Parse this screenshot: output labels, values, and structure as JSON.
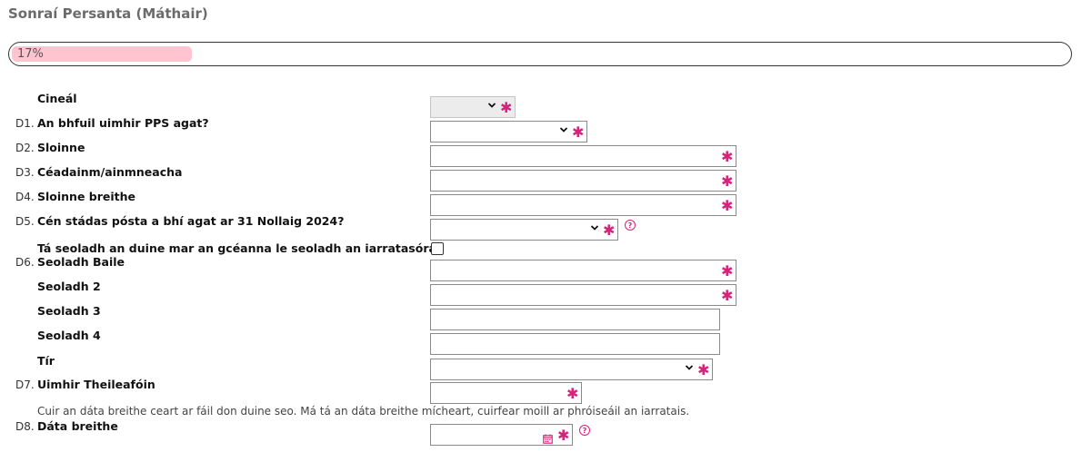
{
  "page": {
    "title": "Sonraí Persanta (Máthair)"
  },
  "progress": {
    "percent": 17,
    "label": "17%"
  },
  "colors": {
    "required": "#d4237a",
    "progress_fill": "#ffc4cf",
    "title": "#6b6b6b"
  },
  "icons": {
    "required": "asterisk-icon",
    "help": "question-circle-icon",
    "calendar": "calendar-icon",
    "dropdown": "chevron-down-icon"
  },
  "form": {
    "cineal": {
      "number": "",
      "label": "Cineál",
      "required_mark": "✱"
    },
    "d1": {
      "number": "D1.",
      "label": "An bhfuil uimhir PPS agat?",
      "required_mark": "✱"
    },
    "d2": {
      "number": "D2.",
      "label": "Sloinne",
      "value": "",
      "required_mark": "✱"
    },
    "d3": {
      "number": "D3.",
      "label": "Céadainm/ainmneacha",
      "value": "",
      "required_mark": "✱"
    },
    "d4": {
      "number": "D4.",
      "label": "Sloinne breithe",
      "value": "",
      "required_mark": "✱"
    },
    "d5": {
      "number": "D5.",
      "label": "Cén stádas pósta a bhí agat ar 31 Nollaig 2024?",
      "required_mark": "✱",
      "help": "?"
    },
    "same_address": {
      "label": "Tá seoladh an duine mar an gcéanna le seoladh an iarratasóra."
    },
    "d6": {
      "number": "D6.",
      "label": "Seoladh Baile",
      "value": "",
      "required_mark": "✱"
    },
    "addr2": {
      "label": "Seoladh 2",
      "value": "",
      "required_mark": "✱"
    },
    "addr3": {
      "label": "Seoladh 3",
      "value": ""
    },
    "addr4": {
      "label": "Seoladh 4",
      "value": ""
    },
    "country": {
      "label": "Tír",
      "required_mark": "✱"
    },
    "d7": {
      "number": "D7.",
      "label": "Uimhir Theileafóin",
      "value": "",
      "required_mark": "✱"
    },
    "dob_note": "Cuir an dáta breithe ceart ar fáil don duine seo. Má tá an dáta breithe mícheart, cuirfear moill ar phróiseáil an iarratais.",
    "d8": {
      "number": "D8.",
      "label": "Dáta breithe",
      "value": "",
      "required_mark": "✱",
      "help": "?"
    }
  }
}
